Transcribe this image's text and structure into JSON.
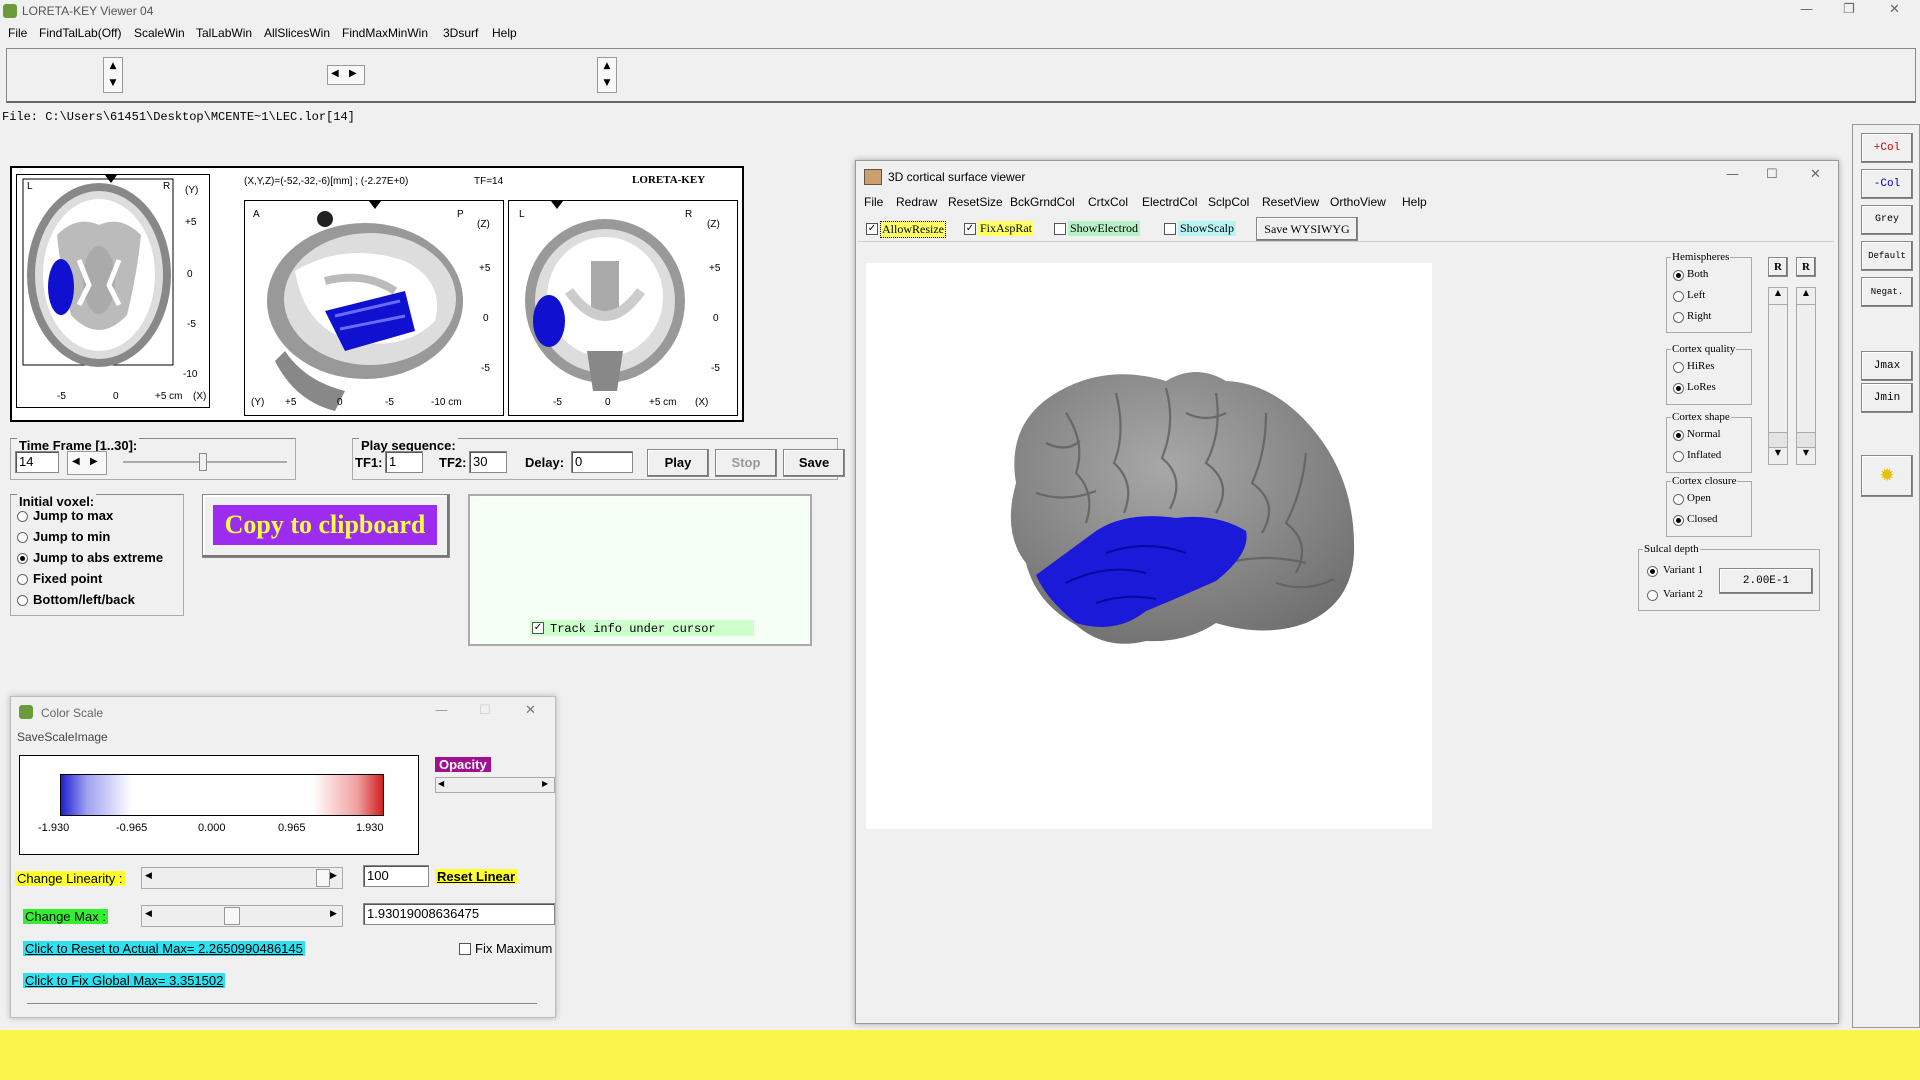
{
  "app": {
    "title": "LORETA-KEY Viewer 04",
    "menu": [
      "File",
      "FindTalLab(Off)",
      "ScaleWin",
      "TalLabWin",
      "AllSlicesWin",
      "FindMaxMinWin",
      "3Dsurf",
      "Help"
    ],
    "file_path": "File: C:\\Users\\61451\\Desktop\\MCENTE~1\\LEC.lor[14]"
  },
  "mri": {
    "coord_readout": "(X,Y,Z)=(-52,-32,-6)[mm] ; (-2.27E+0)",
    "tf_label": "TF=14",
    "brand": "LORETA-KEY",
    "axial": {
      "left": "L",
      "right": "R",
      "axis": "(Y)",
      "yticks": [
        "+5",
        "0",
        "-5",
        "-10"
      ],
      "xticks": [
        "-5",
        "0",
        "+5 cm",
        "(X)"
      ]
    },
    "sagittal": {
      "left": "A",
      "right": "P",
      "axis": "(Z)",
      "yticks": [
        "+5",
        "0",
        "-5"
      ],
      "xticks": [
        "(Y)",
        "+5",
        "0",
        "-5",
        "-10 cm"
      ]
    },
    "coronal": {
      "left": "L",
      "right": "R",
      "axis": "(Z)",
      "yticks": [
        "+5",
        "0",
        "-5"
      ],
      "xticks": [
        "-5",
        "0",
        "+5 cm",
        "(X)"
      ]
    }
  },
  "timeframe": {
    "label": "Time Frame [1..30]:",
    "value": "14"
  },
  "play": {
    "label": "Play sequence:",
    "tf1_label": "TF1:",
    "tf1": "1",
    "tf2_label": "TF2:",
    "tf2": "30",
    "delay_label": "Delay:",
    "delay": "0",
    "play": "Play",
    "stop": "Stop",
    "save": "Save"
  },
  "initial_voxel": {
    "label": "Initial voxel:",
    "options": [
      "Jump to max",
      "Jump to min",
      "Jump to abs extreme",
      "Fixed point",
      "Bottom/left/back"
    ],
    "selected": 2
  },
  "copy_button": "Copy to clipboard",
  "track_info": "Track info under cursor",
  "win3d": {
    "title": "3D cortical surface viewer",
    "menu": [
      "File",
      "Redraw",
      "ResetSize",
      "BckGrndCol",
      "CrtxCol",
      "ElectrdCol",
      "SclpCol",
      "ResetView",
      "OrthoView",
      "Help"
    ],
    "checks": [
      {
        "label": "AllowResize",
        "checked": true,
        "bg": "#ffff66"
      },
      {
        "label": "FixAspRat",
        "checked": true,
        "bg": "#ffff66"
      },
      {
        "label": "ShowElectrod",
        "checked": false,
        "bg": "#b8f0c8"
      },
      {
        "label": "ShowScalp",
        "checked": false,
        "bg": "#b8f4f4"
      }
    ],
    "save_btn": "Save WYSIWYG",
    "hemispheres": {
      "label": "Hemispheres",
      "options": [
        "Both",
        "Left",
        "Right"
      ],
      "selected": 0
    },
    "quality": {
      "label": "Cortex quality",
      "options": [
        "HiRes",
        "LoRes"
      ],
      "selected": 1
    },
    "shape": {
      "label": "Cortex shape",
      "options": [
        "Normal",
        "Inflated"
      ],
      "selected": 0
    },
    "closure": {
      "label": "Cortex closure",
      "options": [
        "Open",
        "Closed"
      ],
      "selected": 1
    },
    "sulcal": {
      "label": "Sulcal depth",
      "options": [
        "Variant 1",
        "Variant 2"
      ],
      "selected": 0,
      "value": "2.00E-1"
    },
    "r_btn": "R"
  },
  "rightbar": {
    "buttons": [
      "+Col",
      "-Col",
      "Grey",
      "Default",
      "Negat.",
      "Jmax",
      "Jmin"
    ],
    "plus_color": "#d00000",
    "minus_color": "#0000c0"
  },
  "color_scale": {
    "title": "Color Scale",
    "menu": "SaveScaleImage",
    "ticks": [
      "-1.930",
      "-0.965",
      "0.000",
      "0.965",
      "1.930"
    ],
    "opacity_label": "Opacity",
    "linearity_label": "Change Linearity :",
    "linearity_value": "100",
    "reset_linear": "Reset Linear",
    "max_label": "Change Max :",
    "max_value": "1.93019008636475",
    "reset_max": "Click to Reset to Actual Max= 2.2650990486145",
    "fix_max_label": "Fix Maximum",
    "global_max": "Click to Fix Global Max= 3.351502"
  }
}
